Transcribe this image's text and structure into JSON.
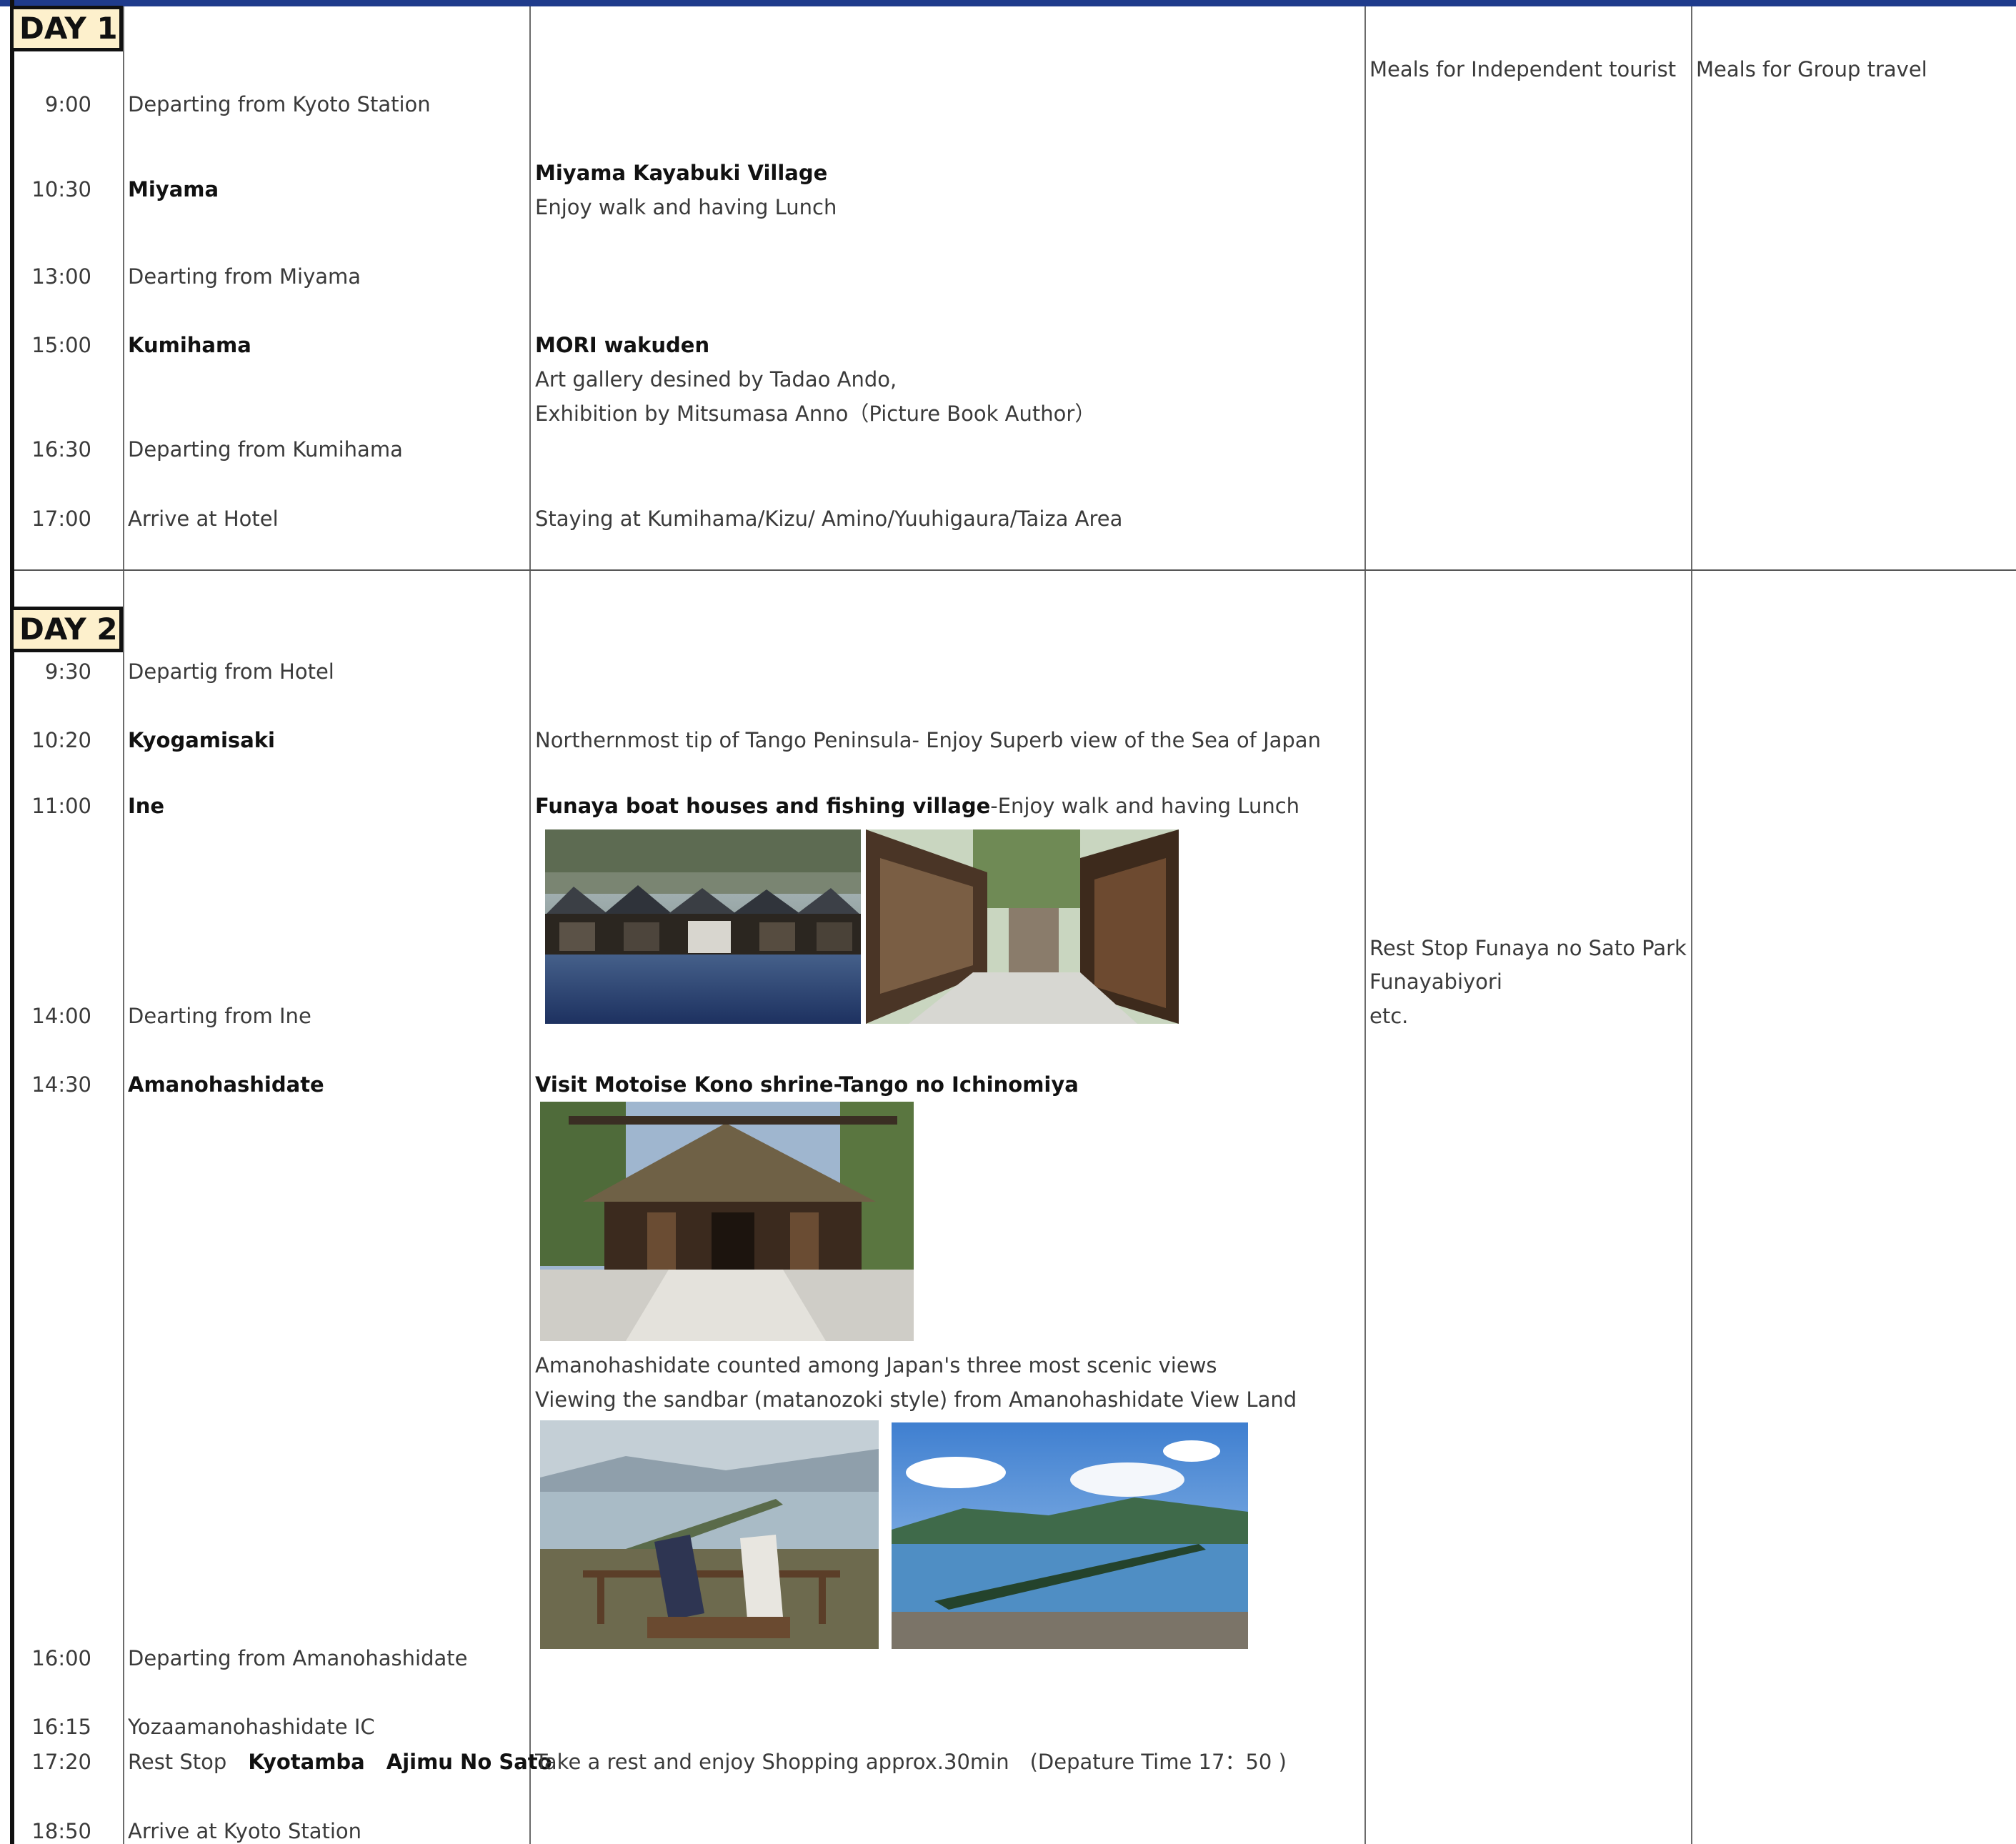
{
  "columns": {
    "independent_meals": "Meals for Independent tourist",
    "group_meals": "Meals for Group travel"
  },
  "day1": {
    "label": "DAY 1",
    "rows": [
      {
        "time": "9:00",
        "place": "Departing from Kyoto Station"
      },
      {
        "time": "10:30",
        "place": "Miyama",
        "title": "Miyama Kayabuki Village",
        "desc": "Enjoy walk and having Lunch"
      },
      {
        "time": "13:00",
        "place": "Dearting from Miyama"
      },
      {
        "time": "15:00",
        "place": "Kumihama",
        "title": "MORI wakuden",
        "desc1": "Art gallery desined by Tadao Ando,",
        "desc2": "Exhibition by Mitsumasa Anno（Picture Book Author）"
      },
      {
        "time": "16:30",
        "place": "Departing from Kumihama"
      },
      {
        "time": "17:00",
        "place": "Arrive at Hotel",
        "desc": "Staying at Kumihama/Kizu/ Amino/Yuuhigaura/Taiza Area"
      }
    ]
  },
  "day2": {
    "label": "DAY 2",
    "rows": [
      {
        "time": "9:30",
        "place": "Departig from Hotel"
      },
      {
        "time": "10:20",
        "place": "Kyogamisaki",
        "desc": "Northernmost tip of Tango Peninsula- Enjoy Superb view of the Sea of Japan"
      },
      {
        "time": "11:00",
        "place": "Ine",
        "title": "Funaya boat houses and fishing village",
        "desc": "-Enjoy walk and having Lunch"
      },
      {
        "time": "14:00",
        "place": "Dearting from Ine"
      },
      {
        "time": "14:30",
        "place": "Amanohashidate",
        "title": "Visit Motoise Kono shrine-Tango no Ichinomiya",
        "desc1": "Amanohashidate counted among Japan's three most scenic views",
        "desc2": "Viewing the sandbar (matanozoki style) from Amanohashidate View Land"
      },
      {
        "time": "16:00",
        "place": "Departing from Amanohashidate"
      },
      {
        "time": "16:15",
        "place": "Yozaamanohashidate IC"
      },
      {
        "time": "17:20",
        "place_prefix": "Rest Stop",
        "place_b1": "Kyotamba",
        "place_b2": "Ajimu No Sato",
        "desc": "Take a rest and enjoy Shopping approx.30min　(Depature Time 17：50 )"
      },
      {
        "time": "18:50",
        "place": "Arrive at Kyoto Station"
      }
    ],
    "meals_independent": [
      "Rest Stop Funaya no Sato Park",
      "Funayabiyori",
      "etc."
    ]
  },
  "colors": {
    "accent_bar": "#1f3b8c",
    "day_label_bg": "#fdf0cc"
  }
}
